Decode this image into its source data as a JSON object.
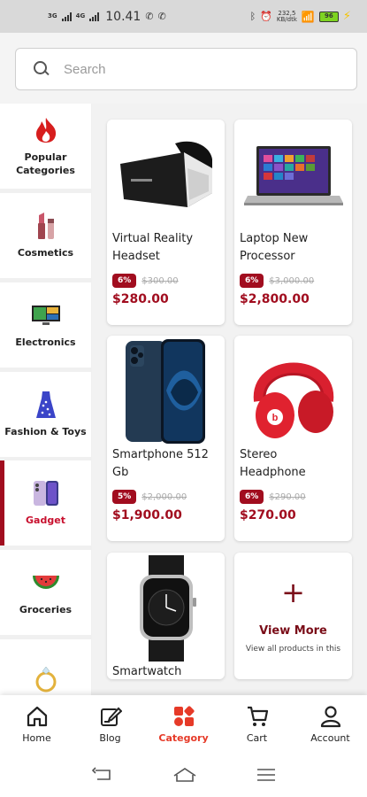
{
  "status_bar": {
    "net1": "3G",
    "net2": "4G",
    "time": "10.41",
    "speed_value": "232,5",
    "speed_unit": "KB/dtk",
    "battery": "96"
  },
  "search": {
    "placeholder": "Search"
  },
  "categories": [
    {
      "label": "Popular Categories",
      "icon": "fire-icon",
      "active": false
    },
    {
      "label": "Cosmetics",
      "icon": "lipstick-icon",
      "active": false
    },
    {
      "label": "Electronics",
      "icon": "tv-icon",
      "active": false
    },
    {
      "label": "Fashion & Toys",
      "icon": "dress-icon",
      "active": false
    },
    {
      "label": "Gadget",
      "icon": "phone-icon",
      "active": true
    },
    {
      "label": "Groceries",
      "icon": "watermelon-icon",
      "active": false
    },
    {
      "label": "",
      "icon": "ring-icon",
      "active": false
    }
  ],
  "products": [
    {
      "name": "Virtual Reality Headset",
      "discount": "6%",
      "old_price": "$300.00",
      "price": "$280.00",
      "image": "vr-headset-image"
    },
    {
      "name": "Laptop New Processor",
      "discount": "6%",
      "old_price": "$3,000.00",
      "price": "$2,800.00",
      "image": "laptop-image"
    },
    {
      "name": "Smartphone 512 Gb",
      "discount": "5%",
      "old_price": "$2,000.00",
      "price": "$1,900.00",
      "image": "smartphone-image"
    },
    {
      "name": "Stereo Headphone",
      "discount": "6%",
      "old_price": "$290.00",
      "price": "$270.00",
      "image": "headphone-image"
    },
    {
      "name": "Smartwatch",
      "image": "smartwatch-image"
    }
  ],
  "view_more": {
    "label": "View More",
    "subtitle": "View all products in this"
  },
  "bottom_nav": [
    {
      "label": "Home",
      "icon": "home-icon",
      "active": false
    },
    {
      "label": "Blog",
      "icon": "blog-icon",
      "active": false
    },
    {
      "label": "Category",
      "icon": "category-icon",
      "active": true
    },
    {
      "label": "Cart",
      "icon": "cart-icon",
      "active": false
    },
    {
      "label": "Account",
      "icon": "account-icon",
      "active": false
    }
  ],
  "colors": {
    "accent": "#a10d1f",
    "active_nav": "#e63a28",
    "price": "#a10d1f"
  }
}
